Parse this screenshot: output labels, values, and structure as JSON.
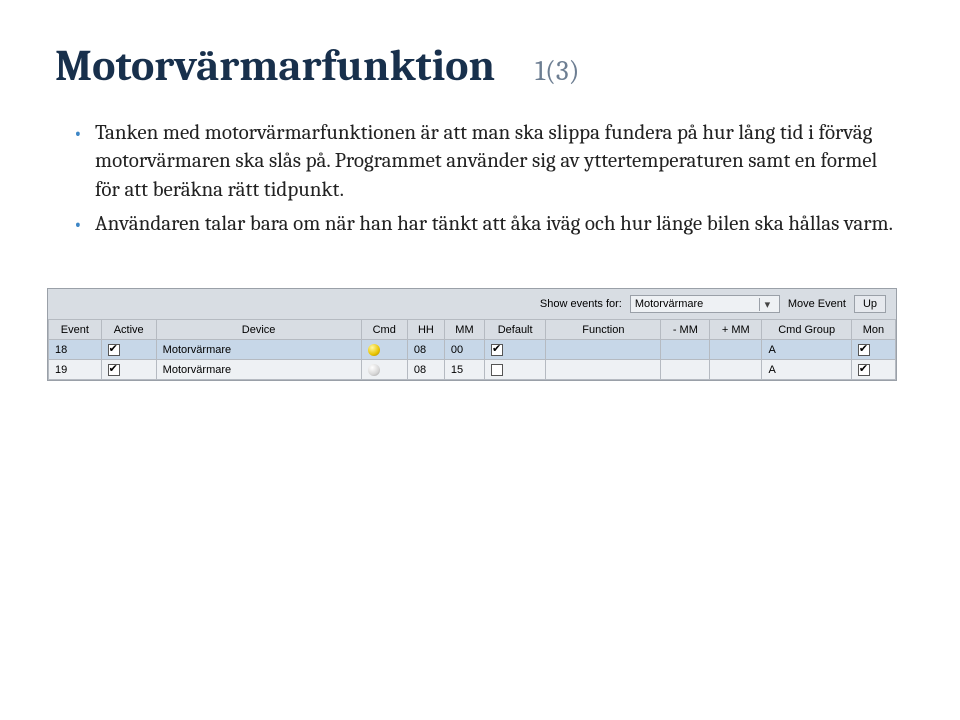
{
  "title": "Motorvärmarfunktion",
  "pagenum": "1(3)",
  "bullets": [
    "Tanken med motorvärmarfunktionen är att man ska slippa fundera på hur lång tid i förväg motorvärmaren ska slås på. Programmet använder sig av yttertemperaturen samt en formel för att beräkna rätt tidpunkt.",
    "Användaren talar bara om när han har tänkt att åka iväg och hur länge bilen ska hållas varm."
  ],
  "panel": {
    "show_label": "Show events for:",
    "filter_value": "Motorvärmare",
    "move_label": "Move Event",
    "up_label": "Up"
  },
  "columns": [
    "Event",
    "Active",
    "Device",
    "Cmd",
    "HH",
    "MM",
    "Default",
    "Function",
    "- MM",
    "+ MM",
    "Cmd Group",
    "Mon"
  ],
  "rows": [
    {
      "event": "18",
      "active": true,
      "device": "Motorvärmare",
      "cmd": "on",
      "hh": "08",
      "mm": "00",
      "def": true,
      "func": "",
      "mminus": "",
      "mplus": "",
      "grp": "A",
      "mon": true
    },
    {
      "event": "19",
      "active": true,
      "device": "Motorvärmare",
      "cmd": "off",
      "hh": "08",
      "mm": "15",
      "def": false,
      "func": "",
      "mminus": "",
      "mplus": "",
      "grp": "A",
      "mon": true
    }
  ]
}
